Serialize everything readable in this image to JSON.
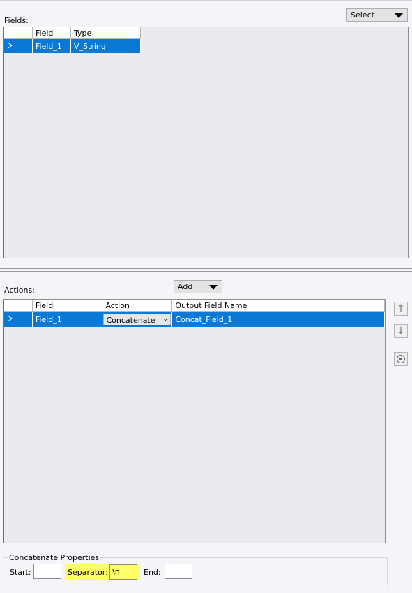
{
  "fields": {
    "label": "Fields:",
    "select_label": "Select",
    "columns": [
      "Field",
      "Type"
    ],
    "rows": [
      {
        "field": "Field_1",
        "type": "V_String"
      }
    ]
  },
  "actions": {
    "label": "Actions:",
    "add_label": "Add",
    "columns": [
      "Field",
      "Action",
      "Output Field Name"
    ],
    "rows": [
      {
        "field": "Field_1",
        "action": "Concatenate",
        "output": "Concat_Field_1"
      }
    ]
  },
  "side_buttons": {
    "up_icon": "arrow-up-icon",
    "down_icon": "arrow-down-icon",
    "remove_icon": "remove-icon"
  },
  "properties": {
    "title": "Concatenate Properties",
    "start_label": "Start:",
    "start_value": "",
    "separator_label": "Separator:",
    "separator_value": "\\n",
    "end_label": "End:",
    "end_value": ""
  },
  "colors": {
    "selection": "#0a78d7",
    "highlight": "#ffff66"
  }
}
